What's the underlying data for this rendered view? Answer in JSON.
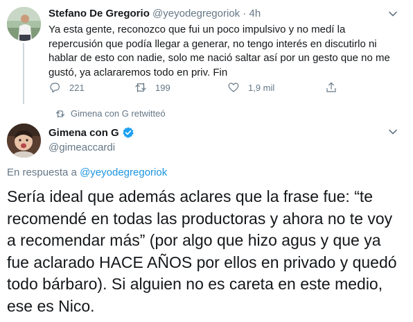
{
  "parent_tweet": {
    "name": "Stefano De Gregorio",
    "handle": "@yeyodegregoriok",
    "separator": "·",
    "time": "4h",
    "text": "Ya esta gente, reconozco que fui un poco impulsivo y no medí la repercusión que podía llegar a generar, no tengo interés en discutirlo ni hablar de esto con nadie, solo me nació saltar así por un gesto que no me gustó, ya aclararemos todo en priv. Fin",
    "reply_count": "221",
    "retweet_count": "199",
    "like_count": "1,9 mil"
  },
  "retweet_context": {
    "label": "Gimena con G retwitteó"
  },
  "main_tweet": {
    "name": "Gimena con G",
    "handle": "@gimeaccardi",
    "reply_prefix": "En respuesta a ",
    "reply_to": "@yeyodegregoriok",
    "text": "Sería ideal que además aclares que la frase fue: “te recomendé en todas las productoras y ahora no te voy a recomendar más” (por algo que hizo agus y que ya fue aclarado HACE AÑOS por ellos en privado y quedó todo bárbaro). Si alguien no es careta en este medio, ese es Nico."
  },
  "icons": {
    "reply": "reply-icon",
    "retweet": "retweet-icon",
    "like": "heart-icon",
    "share": "share-icon",
    "verified": "verified-badge-icon",
    "more": "chevron-down-icon"
  },
  "colors": {
    "text": "#14171a",
    "secondary": "#657786",
    "link": "#1b95e0",
    "verified": "#1da1f2",
    "thread_line": "#ccd6dd"
  }
}
